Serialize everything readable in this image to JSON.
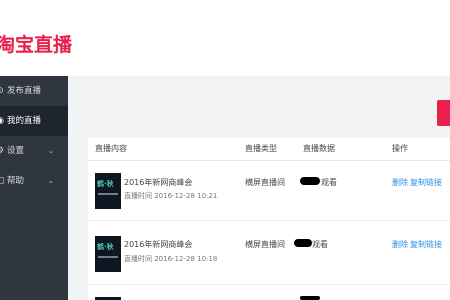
{
  "header": {
    "logo_text": "淘宝直播"
  },
  "sidebar": {
    "items": [
      {
        "icon": "publish-icon",
        "glyph": "⊙",
        "label": "发布直播",
        "chevron": ""
      },
      {
        "icon": "live-icon",
        "glyph": "◉",
        "label": "我的直播",
        "chevron": ""
      },
      {
        "icon": "settings-icon",
        "glyph": "⚙",
        "label": "设置",
        "chevron": "⌄"
      },
      {
        "icon": "help-icon",
        "glyph": "▢",
        "label": "帮助",
        "chevron": "⌄"
      }
    ]
  },
  "table": {
    "headers": [
      "直播内容",
      "直播类型",
      "直播数据",
      "操作"
    ],
    "rows": [
      {
        "thumb_text": "鹤·秋",
        "title": "2016年新网商峰会",
        "time": "直播时间 2016-12-28 10:21",
        "type": "横屏直播间",
        "data_suffix": "观看",
        "action_delete": "删除",
        "action_copy": "复制链接"
      },
      {
        "thumb_text": "鹤·秋",
        "title": "2016年新网商峰会",
        "time": "直播时间 2016-12-28 10:18",
        "type": "横屏直播间",
        "data_suffix": "观看",
        "action_delete": "删除",
        "action_copy": "复制链接"
      }
    ]
  },
  "colors": {
    "brand": "#e8204b",
    "sidebar": "#2f3640",
    "link": "#2a8fe3"
  }
}
